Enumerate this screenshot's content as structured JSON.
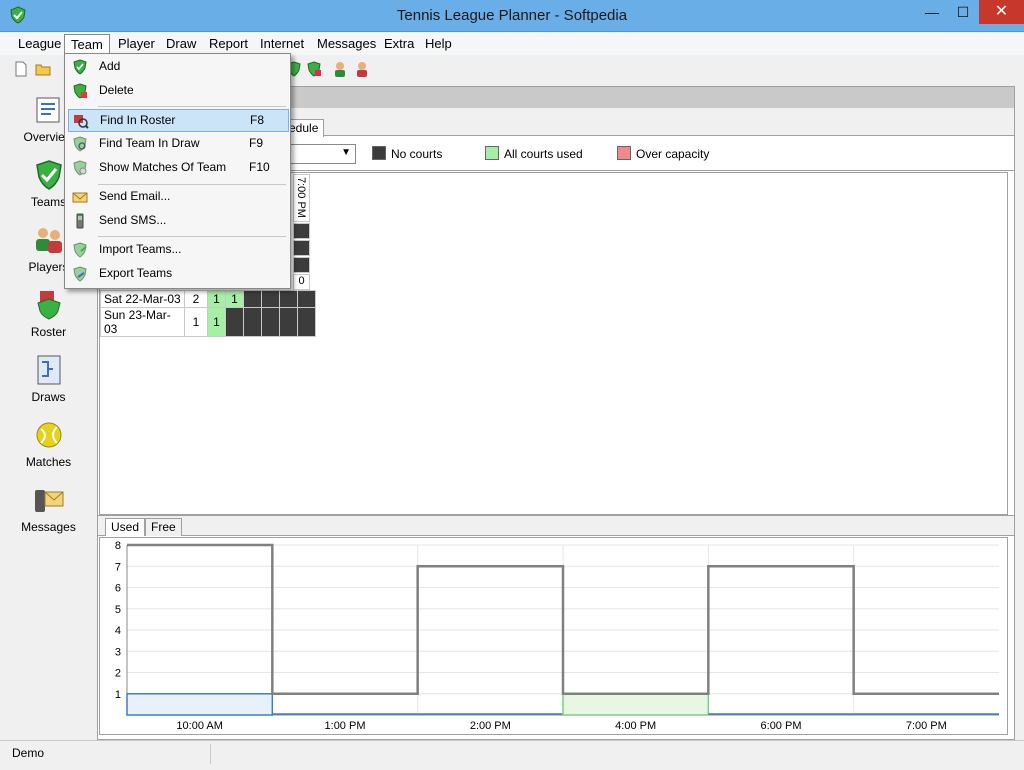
{
  "window": {
    "title": "Tennis League Planner - Softpedia",
    "minimize": "—",
    "maximize": "☐",
    "close": "✕"
  },
  "menubar": [
    "League",
    "Team",
    "Player",
    "Draw",
    "Report",
    "Internet",
    "Messages",
    "Extra",
    "Help"
  ],
  "team_menu": {
    "items": [
      {
        "label": "Add",
        "shortcut": "",
        "icon": "shield-icon"
      },
      {
        "label": "Delete",
        "shortcut": "",
        "icon": "shield-delete-icon"
      },
      {
        "label": "Find In Roster",
        "shortcut": "F8",
        "icon": "find-roster-icon"
      },
      {
        "label": "Find Team In Draw",
        "shortcut": "F9",
        "icon": "find-draw-icon"
      },
      {
        "label": "Show Matches Of Team",
        "shortcut": "F10",
        "icon": "matches-icon"
      },
      {
        "label": "Send Email...",
        "shortcut": "",
        "icon": "envelope-icon"
      },
      {
        "label": "Send SMS...",
        "shortcut": "",
        "icon": "phone-icon"
      },
      {
        "label": "Import Teams...",
        "shortcut": "",
        "icon": "import-icon"
      },
      {
        "label": "Export Teams",
        "shortcut": "",
        "icon": "export-icon"
      }
    ]
  },
  "nav": [
    {
      "label": "Overview",
      "icon": "overview-icon"
    },
    {
      "label": "Teams",
      "icon": "shield-icon"
    },
    {
      "label": "Players",
      "icon": "players-icon"
    },
    {
      "label": "Roster",
      "icon": "roster-icon"
    },
    {
      "label": "Draws",
      "icon": "draws-icon"
    },
    {
      "label": "Matches",
      "icon": "ball-icon"
    },
    {
      "label": "Messages",
      "icon": "messages-icon"
    }
  ],
  "main": {
    "tab_partial": "edule",
    "legend": [
      {
        "label": "No courts",
        "color": "#3c3c3c"
      },
      {
        "label": "All courts used",
        "color": "#a6f0a6"
      },
      {
        "label": "Over capacity",
        "color": "#f08a8a"
      }
    ],
    "grid_header": "7:00 PM",
    "rows": [
      {
        "date": "",
        "count": "",
        "c1": "",
        "c2": "",
        "last": "0"
      },
      {
        "date": "Sat 22-Mar-03",
        "count": "2",
        "c1": "1",
        "c2": "1",
        "last": ""
      },
      {
        "date": "Sun 23-Mar-03",
        "count": "1",
        "c1": "1",
        "c2": "",
        "last": ""
      }
    ],
    "bottom_tabs": [
      "Used",
      "Free"
    ]
  },
  "chart_data": {
    "type": "line",
    "step": true,
    "x": [
      "10:00 AM",
      "1:00 PM",
      "2:00 PM",
      "4:00 PM",
      "6:00 PM",
      "7:00 PM"
    ],
    "series": [
      {
        "values": [
          8,
          1,
          7,
          1,
          7,
          1
        ]
      },
      {
        "values": [
          1,
          0,
          0,
          1,
          0,
          0
        ]
      }
    ],
    "ylim": [
      0,
      8
    ],
    "yticks": [
      1,
      2,
      3,
      4,
      5,
      6,
      7,
      8
    ],
    "grid": true
  },
  "status": {
    "text": "Demo"
  }
}
